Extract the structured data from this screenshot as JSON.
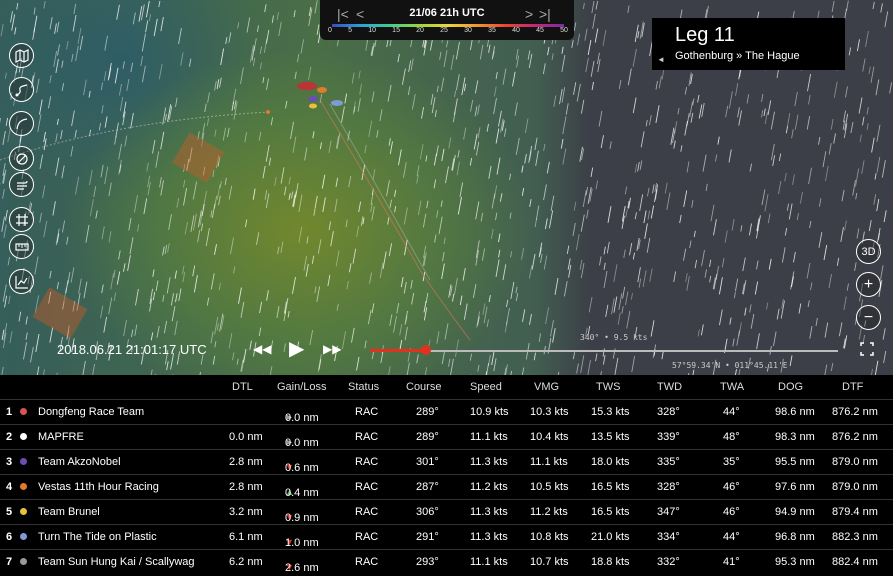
{
  "timebar": {
    "first_label": "|<",
    "prev_label": "<",
    "date": "21/06 21h UTC",
    "next_label": ">",
    "last_label": ">|",
    "ticks": [
      "0",
      "5",
      "10",
      "15",
      "20",
      "25",
      "30",
      "35",
      "40",
      "45",
      "50"
    ]
  },
  "leg": {
    "title": "Leg 11",
    "route": "Gothenburg » The Hague",
    "toggle": "◄"
  },
  "playback": {
    "timestamp": "2018.06.21 21:01:17 UTC",
    "rewind": "◀◀",
    "play": "▶",
    "forward": "▶▶",
    "progress": 0.12,
    "wind_readout": "340° • 9.5 kts",
    "position_readout": "57°59.34'N • 011°45.11'E"
  },
  "right_tools": {
    "view_3d": "3D",
    "zoom_in": "+",
    "zoom_out": "−"
  },
  "table": {
    "headers": [
      "DTL",
      "Gain/Loss",
      "Status",
      "Course",
      "Speed",
      "VMG",
      "TWS",
      "TWD",
      "TWA",
      "DOG",
      "DTF"
    ],
    "rows": [
      {
        "rank": "1",
        "color": "#d9534f",
        "team": "Dongfeng Race Team",
        "dtl": "",
        "trend": "flat",
        "gain": "0.0 nm",
        "status": "RAC",
        "course": "289°",
        "speed": "10.9 kts",
        "vmg": "10.3 kts",
        "tws": "15.3 kts",
        "twd": "328°",
        "twa": "44°",
        "dog": "98.6 nm",
        "dtf": "876.2 nm"
      },
      {
        "rank": "2",
        "color": "#ffffff",
        "team": "MAPFRE",
        "dtl": "0.0 nm",
        "trend": "flat",
        "gain": "0.0 nm",
        "status": "RAC",
        "course": "289°",
        "speed": "11.1 kts",
        "vmg": "10.4 kts",
        "tws": "13.5 kts",
        "twd": "339°",
        "twa": "48°",
        "dog": "98.3 nm",
        "dtf": "876.2 nm"
      },
      {
        "rank": "3",
        "color": "#6a4fb0",
        "team": "Team AkzoNobel",
        "dtl": "2.8 nm",
        "trend": "down",
        "gain": "0.6 nm",
        "status": "RAC",
        "course": "301°",
        "speed": "11.3 kts",
        "vmg": "11.1 kts",
        "tws": "18.0 kts",
        "twd": "335°",
        "twa": "35°",
        "dog": "95.5 nm",
        "dtf": "879.0 nm"
      },
      {
        "rank": "4",
        "color": "#e07b2a",
        "team": "Vestas 11th Hour Racing",
        "dtl": "2.8 nm",
        "trend": "up",
        "gain": "0.4 nm",
        "status": "RAC",
        "course": "287°",
        "speed": "11.2 kts",
        "vmg": "10.5 kts",
        "tws": "16.5 kts",
        "twd": "328°",
        "twa": "46°",
        "dog": "97.6 nm",
        "dtf": "879.0 nm"
      },
      {
        "rank": "5",
        "color": "#e8c13a",
        "team": "Team Brunel",
        "dtl": "3.2 nm",
        "trend": "down",
        "gain": "0.9 nm",
        "status": "RAC",
        "course": "306°",
        "speed": "11.3 kts",
        "vmg": "11.2 kts",
        "tws": "16.5 kts",
        "twd": "347°",
        "twa": "46°",
        "dog": "94.9 nm",
        "dtf": "879.4 nm"
      },
      {
        "rank": "6",
        "color": "#7e9bd6",
        "team": "Turn The Tide on Plastic",
        "dtl": "6.1 nm",
        "trend": "down",
        "gain": "1.0 nm",
        "status": "RAC",
        "course": "291°",
        "speed": "11.3 kts",
        "vmg": "10.8 kts",
        "tws": "21.0 kts",
        "twd": "334°",
        "twa": "44°",
        "dog": "96.8 nm",
        "dtf": "882.3 nm"
      },
      {
        "rank": "7",
        "color": "#999999",
        "team": "Team Sun Hung Kai / Scallywag",
        "dtl": "6.2 nm",
        "trend": "down",
        "gain": "2.6 nm",
        "status": "RAC",
        "course": "293°",
        "speed": "11.1 kts",
        "vmg": "10.7 kts",
        "tws": "18.8 kts",
        "twd": "332°",
        "twa": "41°",
        "dog": "95.3 nm",
        "dtf": "882.4 nm"
      }
    ]
  },
  "colors": {
    "accent": "#e2311d",
    "up": "#5cb85c",
    "down": "#e2311d",
    "flat": "#999999"
  }
}
